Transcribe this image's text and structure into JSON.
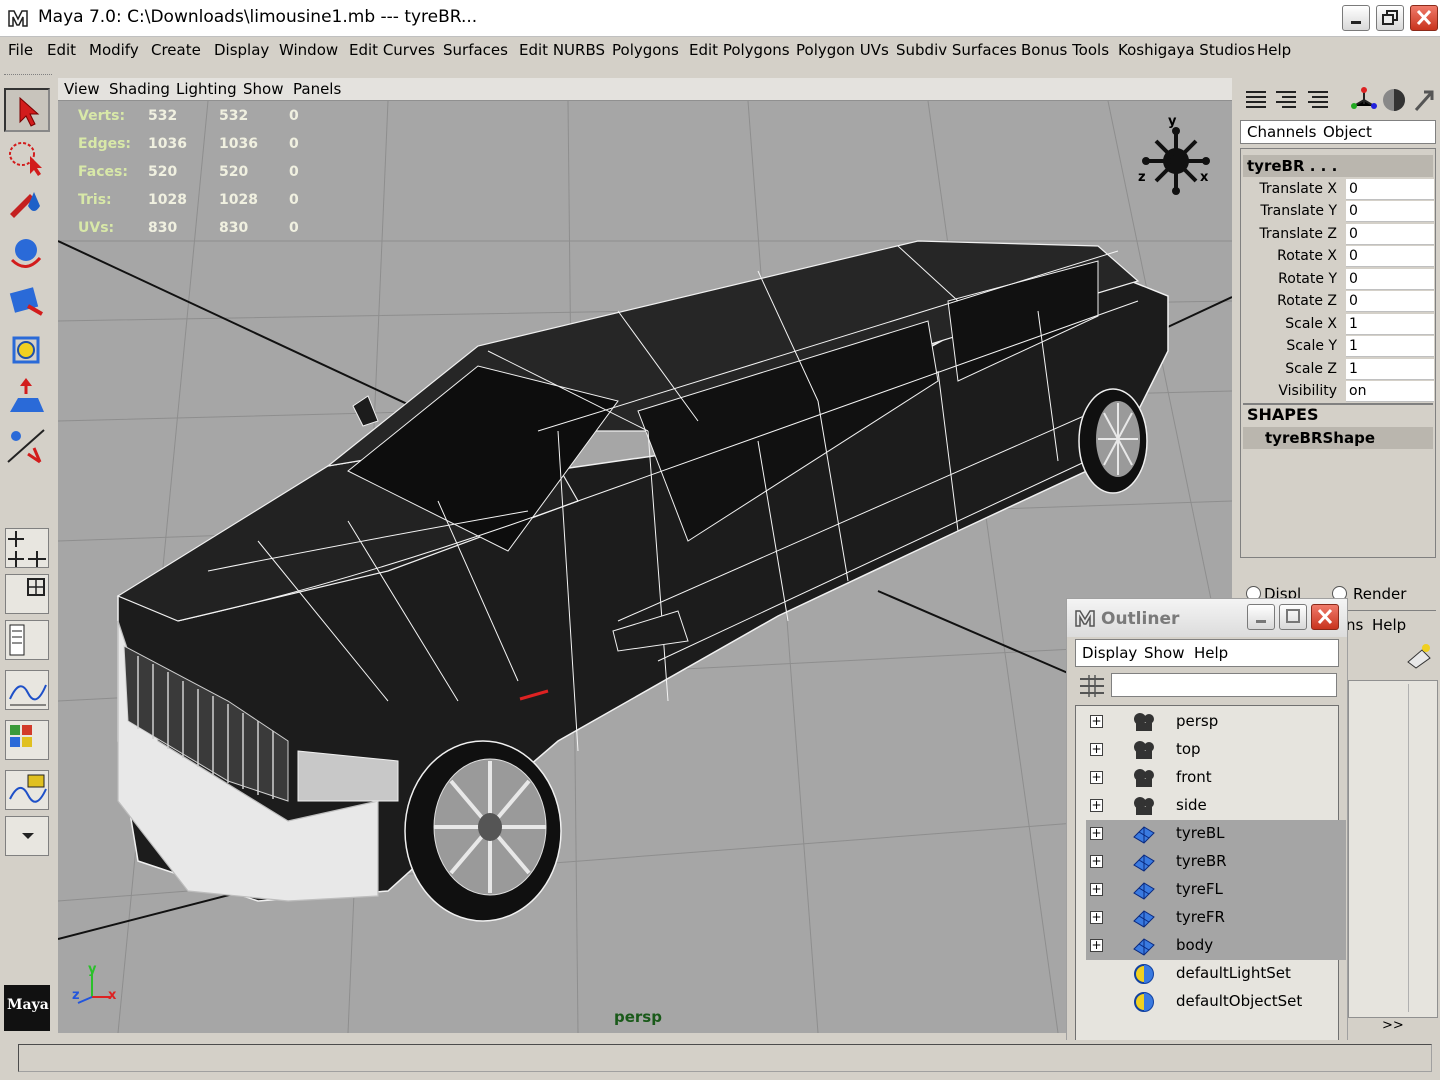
{
  "window": {
    "title": "Maya 7.0: C:\\Downloads\\limousine1.mb   ---   tyreBR...",
    "colors": {
      "viewport_bg": "#a6a6a6",
      "selected_bg": "#a5a5a5",
      "hud_text": "#f0f0e0"
    }
  },
  "menubar": {
    "items": [
      "File",
      "Edit",
      "Modify",
      "Create",
      "Display",
      "Window",
      "Edit Curves",
      "Surfaces",
      "Edit NURBS",
      "Polygons",
      "Edit Polygons",
      "Polygon UVs",
      "Subdiv Surfaces",
      "Bonus Tools",
      "Koshigaya Studios",
      "Help"
    ]
  },
  "toolbox": {
    "tools": [
      "select-tool-icon",
      "lasso-tool-icon",
      "paint-tool-icon",
      "move-tool-icon",
      "rotate-tool-icon",
      "scale-tool-icon",
      "universal-manip-icon",
      "show-manip-icon"
    ],
    "logo": "Maya"
  },
  "viewport": {
    "panel_menu": [
      "View",
      "Shading",
      "Lighting",
      "Show",
      "Panels"
    ],
    "camera_label": "persp",
    "hud": [
      {
        "label": "Verts:",
        "v1": "532",
        "v2": "532",
        "v3": "0"
      },
      {
        "label": "Edges:",
        "v1": "1036",
        "v2": "1036",
        "v3": "0"
      },
      {
        "label": "Faces:",
        "v1": "520",
        "v2": "520",
        "v3": "0"
      },
      {
        "label": "Tris:",
        "v1": "1028",
        "v2": "1028",
        "v3": "0"
      },
      {
        "label": "UVs:",
        "v1": "830",
        "v2": "830",
        "v3": "0"
      }
    ],
    "view_cube": {
      "y": "y",
      "x": "x",
      "z": "z"
    },
    "axis": {
      "y": "y",
      "x": "x",
      "z": "z"
    }
  },
  "channelbox": {
    "tabs": [
      "Channels",
      "Object"
    ],
    "object_name": "tyreBR . . .",
    "channels": [
      {
        "label": "Translate X",
        "value": "0"
      },
      {
        "label": "Translate Y",
        "value": "0"
      },
      {
        "label": "Translate Z",
        "value": "0"
      },
      {
        "label": "Rotate X",
        "value": "0"
      },
      {
        "label": "Rotate Y",
        "value": "0"
      },
      {
        "label": "Rotate Z",
        "value": "0"
      },
      {
        "label": "Scale X",
        "value": "1"
      },
      {
        "label": "Scale Y",
        "value": "1"
      },
      {
        "label": "Scale Z",
        "value": "1"
      },
      {
        "label": "Visibility",
        "value": "on"
      }
    ],
    "shapes_header": "SHAPES",
    "shape_name": "tyreBRShape",
    "layer_tabs": {
      "display": "Displ",
      "render": "Render"
    },
    "layer_menu": {
      "options": "ns",
      "help": "Help"
    },
    "scroll_label": ">>"
  },
  "outliner": {
    "title": "Outliner",
    "menu": [
      "Display",
      "Show",
      "Help"
    ],
    "search_value": "",
    "items": [
      {
        "name": "persp",
        "icon": "camera-icon",
        "expandable": true,
        "selected": false
      },
      {
        "name": "top",
        "icon": "camera-icon",
        "expandable": true,
        "selected": false
      },
      {
        "name": "front",
        "icon": "camera-icon",
        "expandable": true,
        "selected": false
      },
      {
        "name": "side",
        "icon": "camera-icon",
        "expandable": true,
        "selected": false
      },
      {
        "name": "tyreBL",
        "icon": "mesh-icon",
        "expandable": true,
        "selected": true
      },
      {
        "name": "tyreBR",
        "icon": "mesh-icon",
        "expandable": true,
        "selected": true
      },
      {
        "name": "tyreFL",
        "icon": "mesh-icon",
        "expandable": true,
        "selected": true
      },
      {
        "name": "tyreFR",
        "icon": "mesh-icon",
        "expandable": true,
        "selected": true
      },
      {
        "name": "body",
        "icon": "mesh-icon",
        "expandable": true,
        "selected": true
      },
      {
        "name": "defaultLightSet",
        "icon": "set-icon",
        "expandable": false,
        "selected": false
      },
      {
        "name": "defaultObjectSet",
        "icon": "set-icon",
        "expandable": false,
        "selected": false
      }
    ],
    "expand_glyph": "+"
  },
  "status": {
    "text": ""
  }
}
